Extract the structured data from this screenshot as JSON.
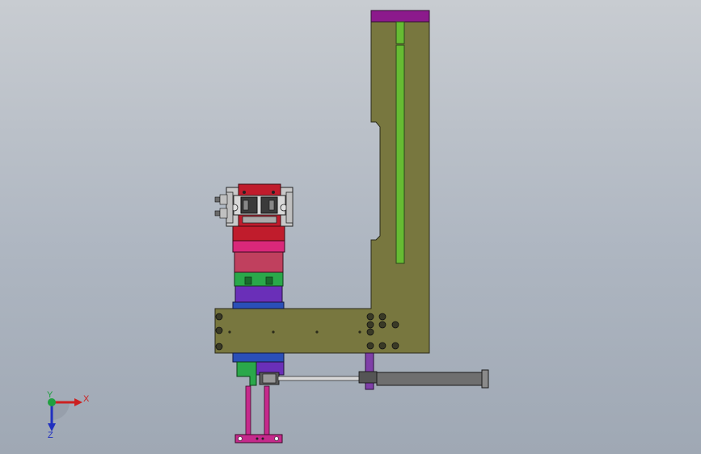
{
  "viewport": {
    "background_top": "#c8ccd1",
    "background_bottom": "#9fa8b4"
  },
  "triad": {
    "x_label": "X",
    "y_label": "Y",
    "z_label": "Z",
    "x_color": "#cc2020",
    "y_color": "#20a040",
    "z_color": "#2030c0"
  },
  "colors": {
    "frame_olive": "#78773f",
    "top_cap_purple": "#8c1a8c",
    "rail_green": "#66bb33",
    "gripper_red": "#c01c2c",
    "block_magenta": "#d9287a",
    "block_rose": "#c0405e",
    "block_green": "#2aa84a",
    "block_violet": "#6a2fb8",
    "block_blue": "#2a4fb8",
    "rod_pink": "#c62a8c",
    "cylinder_gray": "#6f6f6f",
    "bracket_violet": "#7f3fa8"
  }
}
